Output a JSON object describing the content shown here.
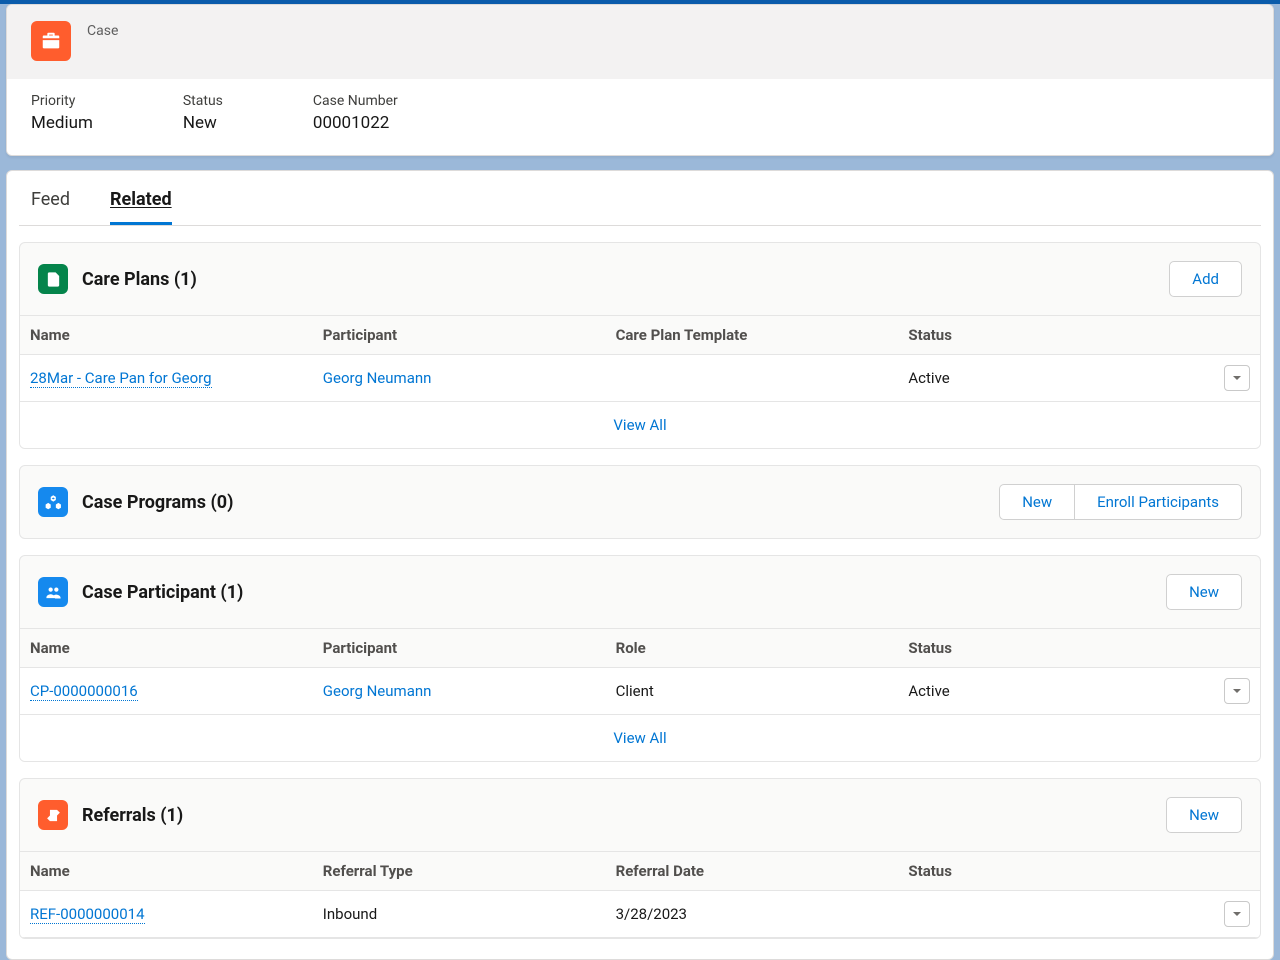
{
  "header": {
    "object_label": "Case",
    "fields": {
      "priority_label": "Priority",
      "priority_value": "Medium",
      "status_label": "Status",
      "status_value": "New",
      "case_number_label": "Case Number",
      "case_number_value": "00001022"
    }
  },
  "tabs": {
    "feed": "Feed",
    "related": "Related",
    "active": "related"
  },
  "common": {
    "view_all": "View All"
  },
  "care_plans": {
    "title": "Care Plans (1)",
    "action_add": "Add",
    "cols": {
      "name": "Name",
      "participant": "Participant",
      "template": "Care Plan Template",
      "status": "Status"
    },
    "rows": [
      {
        "name": "28Mar - Care Pan for Georg",
        "participant": "Georg Neumann",
        "template": "",
        "status": "Active"
      }
    ]
  },
  "case_programs": {
    "title": "Case Programs (0)",
    "action_new": "New",
    "action_enroll": "Enroll Participants"
  },
  "case_participant": {
    "title": "Case Participant (1)",
    "action_new": "New",
    "cols": {
      "name": "Name",
      "participant": "Participant",
      "role": "Role",
      "status": "Status"
    },
    "rows": [
      {
        "name": "CP-0000000016",
        "participant": "Georg Neumann",
        "role": "Client",
        "status": "Active"
      }
    ]
  },
  "referrals": {
    "title": "Referrals (1)",
    "action_new": "New",
    "cols": {
      "name": "Name",
      "type": "Referral Type",
      "date": "Referral Date",
      "status": "Status"
    },
    "rows": [
      {
        "name": "REF-0000000014",
        "type": "Inbound",
        "date": "3/28/2023",
        "status": ""
      }
    ]
  }
}
